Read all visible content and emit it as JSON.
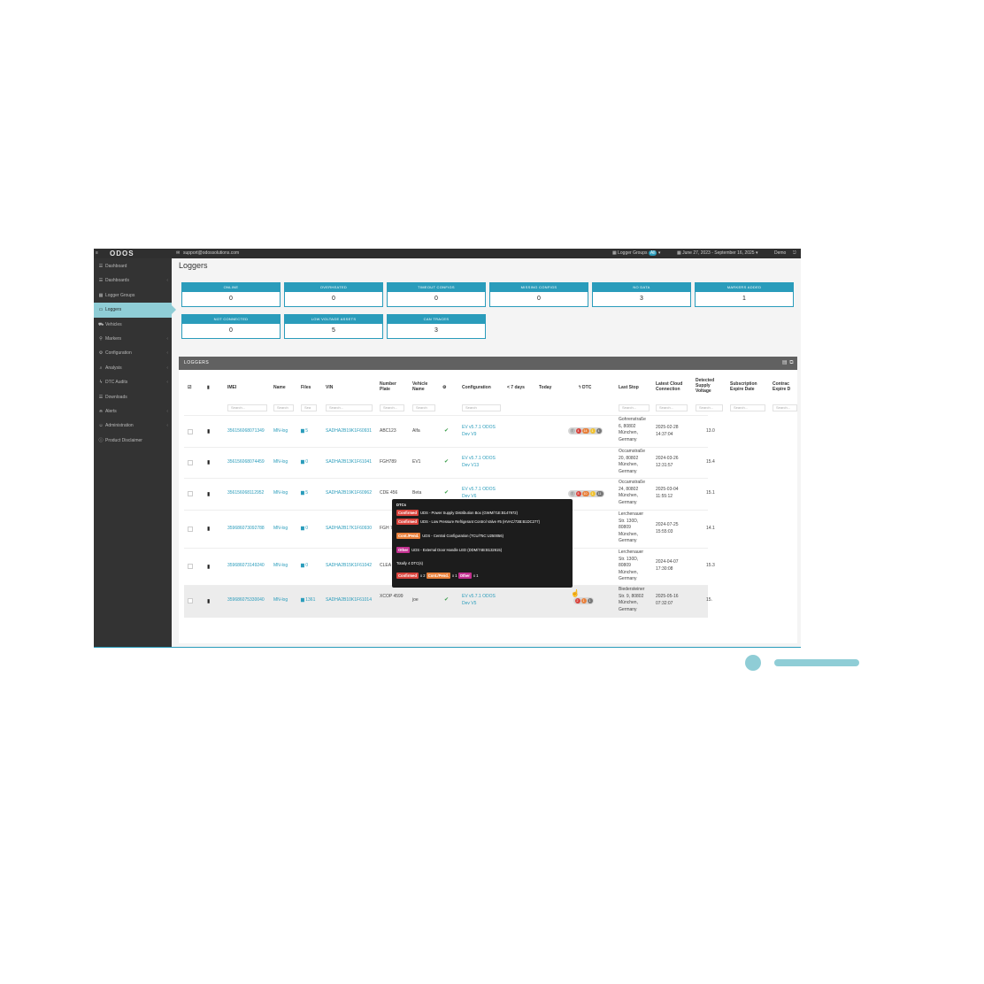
{
  "topbar": {
    "logo": "ODOS",
    "email": "support@odossolutions.com",
    "logger_groups_label": "Logger Groups",
    "logger_groups_badge": "All",
    "date_range": "June 27, 2023 - September 16, 2025",
    "user": "Demo"
  },
  "sidebar": {
    "items": [
      {
        "label": "Dashboard",
        "icon": "list-icon"
      },
      {
        "label": "Dashboards",
        "icon": "list-icon"
      },
      {
        "label": "Logger Groups",
        "icon": "grid-icon"
      },
      {
        "label": "Loggers",
        "icon": "hdd-icon"
      },
      {
        "label": "Vehicles",
        "icon": "car-icon"
      },
      {
        "label": "Markers",
        "icon": "pin-icon"
      },
      {
        "label": "Configuration",
        "icon": "cogs-icon"
      },
      {
        "label": "Analysis",
        "icon": "search-icon"
      },
      {
        "label": "DTC Audits",
        "icon": "bolt-icon"
      },
      {
        "label": "Downloads",
        "icon": "list-icon"
      },
      {
        "label": "Alerts",
        "icon": "bell-icon"
      },
      {
        "label": "Administration",
        "icon": "user-icon"
      },
      {
        "label": "Product Disclaimer",
        "icon": "info-icon"
      }
    ]
  },
  "page": {
    "title": "Loggers"
  },
  "stats": [
    {
      "label": "ONLINE",
      "value": "0"
    },
    {
      "label": "OVERHEATED",
      "value": "0"
    },
    {
      "label": "TIMEOUT CONFIGS",
      "value": "0"
    },
    {
      "label": "MISSING CONFIGS",
      "value": "0"
    },
    {
      "label": "NO DATA",
      "value": "3"
    },
    {
      "label": "MARKERS ADDED",
      "value": "1"
    },
    {
      "label": "NOT CONNECTED",
      "value": "0"
    },
    {
      "label": "LOW VOLTAGE ASSETS",
      "value": "5"
    },
    {
      "label": "CAN TRACES",
      "value": "3"
    }
  ],
  "table": {
    "title": "LOGGERS",
    "columns": {
      "imei": "IMEI",
      "name": "Name",
      "files": "Files",
      "vin": "VIN",
      "plate": "Number Plate",
      "vehicle": "Vehicle Name",
      "config": "Configuration",
      "days7": "< 7 days",
      "today": "Today",
      "dtc": "DTC",
      "last_stop": "Last Stop",
      "latest_cloud": "Latest Cloud Connection",
      "voltage": "Detected Supply Voltage",
      "sub_expire": "Subscription Expire Date",
      "contract": "Contrac Expire D"
    },
    "filters": {
      "search": "Search...",
      "search_short": "Search",
      "sea": "Sea"
    },
    "rows": [
      {
        "imei": "356156068071349",
        "name": "MN-log",
        "files": "5",
        "vin": "SADHA2B19K1F60931",
        "plate": "ABC123",
        "vehicle": "Alfa",
        "config": "EV v5.7.1 ODOS Dev V9",
        "last_stop": "Gohrenstraße 6, 80802 München, Germany",
        "latest": "2025-02-28 14:37:04",
        "voltage": "13.0",
        "dtc": [
          "7",
          "4",
          "14",
          "1",
          "4"
        ]
      },
      {
        "imei": "356156068074459",
        "name": "MN-log",
        "files": "0",
        "vin": "SADHA2B13K1F61041",
        "plate": "FGH789",
        "vehicle": "EV1",
        "config": "EV v5.7.1 ODOS Dev V13",
        "last_stop": "Occamstraße 20, 80802 München, Germany",
        "latest": "2024-03-26 12:31:57",
        "voltage": "15.4",
        "dtc": []
      },
      {
        "imei": "356156068112952",
        "name": "MN-log",
        "files": "5",
        "vin": "SADHA2B19K1F60962",
        "plate": "CDE 456",
        "vehicle": "Beta",
        "config": "EV v5.7.1 ODOS Dev V6",
        "last_stop": "Occamstraße 24, 80802 München, Germany",
        "latest": "2025-03-04 11:55:12",
        "voltage": "15.1",
        "dtc": [
          "7",
          "8",
          "10",
          "1",
          "11"
        ]
      },
      {
        "imei": "359686073092788",
        "name": "MN-log",
        "files": "0",
        "vin": "SADHA2B17K1F60930",
        "plate": "FGH 7",
        "vehicle": "",
        "config": "",
        "last_stop": "Lerchenauer Str. 130D, 80809 München, Germany",
        "latest": "2024-07-25 15:55:03",
        "voltage": "14.1",
        "dtc": []
      },
      {
        "imei": "359686073149240",
        "name": "MN-log",
        "files": "0",
        "vin": "SADHA2B15K1F61042",
        "plate": "CLEA",
        "vehicle": "",
        "config": "",
        "last_stop": "Lerchenauer Str. 130D, 80809 München, Germany",
        "latest": "2024-04-07 17:30:08",
        "voltage": "15.3",
        "dtc": []
      },
      {
        "imei": "359686075330040",
        "name": "MN-log",
        "files": "1361",
        "vin": "SADHA2B10K1F61014",
        "plate": "XCOP 4599",
        "vehicle": "joe",
        "config": "EV v5.7.1 ODOS Dev V5",
        "last_stop": "Biedersteiner Str. 9, 80802 München, Germany",
        "latest": "2025-05-16 07:32:07",
        "voltage": "15.",
        "dtc": [
          "2",
          "1",
          "1"
        ]
      }
    ]
  },
  "tooltip": {
    "title": "DTCs",
    "entries": [
      {
        "tag": "Confirmed",
        "text": "UDS - Power Supply Distribution Box (GWM/71E:B147972)"
      },
      {
        "tag": "Confirmed",
        "text": "UDS - Low Pressure Refrigerant Control Valve #5 (HVAC/73B:B1DC277)"
      },
      {
        "tag": "Cont./Pend.",
        "text": "UDS - Central Configuration (TCU/75C:U250056)"
      },
      {
        "tag": "Other",
        "text": "UDS - External Door Handle LED (DDM/74B:B132615)"
      }
    ],
    "total": "Totally 4 DTC(s)",
    "summary": [
      {
        "tag": "Confirmed",
        "count": "x 2"
      },
      {
        "tag": "Cont./Pend.",
        "count": "x 1"
      },
      {
        "tag": "Other",
        "count": "x 1"
      }
    ]
  },
  "colors": {
    "accent": "#2a9cbb",
    "sidebar": "#333333",
    "active": "#8fcdd6",
    "confirmed": "#d9433c",
    "pending": "#e8803b",
    "other": "#c2308f"
  }
}
